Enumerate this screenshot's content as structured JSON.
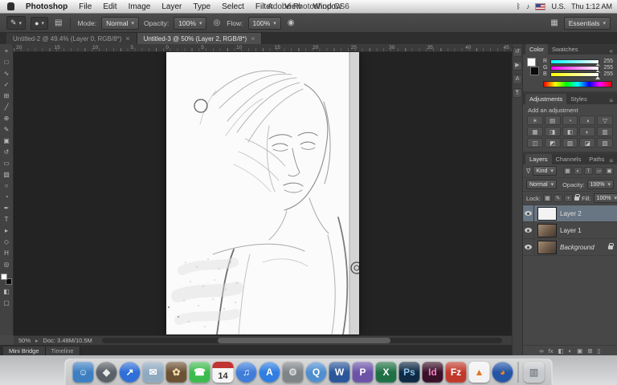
{
  "menubar": {
    "menus": [
      "Photoshop",
      "File",
      "Edit",
      "Image",
      "Layer",
      "Type",
      "Select",
      "Filter",
      "View",
      "Window"
    ],
    "window_title": "Adobe Photoshop CS6",
    "status_icons": [
      {
        "name": "bluetooth-icon",
        "glyph": "ᛒ"
      },
      {
        "name": "volume-icon",
        "glyph": "♪"
      }
    ],
    "input_source": "U.S.",
    "clock": "Thu 1:12 AM"
  },
  "options_bar": {
    "tool_glyph": "✎",
    "brush_preview_glyph": "●",
    "toggle_panel_glyph": "▤",
    "mode_label": "Mode:",
    "mode_value": "Normal",
    "opacity_label": "Opacity:",
    "opacity_value": "100%",
    "pressure_glyph": "◎",
    "flow_label": "Flow:",
    "flow_value": "100%",
    "airbrush_glyph": "◉",
    "workspace_glyph": "▦",
    "workspace_value": "Essentials"
  },
  "document_tabs": [
    {
      "title": "Untitled-2 @ 49.4% (Layer 0, RGB/8*)",
      "close": "×",
      "active": false
    },
    {
      "title": "Untitled-3 @ 50% (Layer 2, RGB/8*)",
      "close": "×",
      "active": true
    }
  ],
  "ruler": {
    "labels": [
      "20",
      "15",
      "10",
      "5",
      "0",
      "5",
      "10",
      "15",
      "20",
      "25",
      "30",
      "35",
      "40",
      "45"
    ]
  },
  "toolbar": {
    "tools": [
      {
        "name": "move-tool",
        "glyph": "+"
      },
      {
        "name": "marquee-tool",
        "glyph": "□"
      },
      {
        "name": "lasso-tool",
        "glyph": "∿"
      },
      {
        "name": "quick-selection-tool",
        "glyph": "✓"
      },
      {
        "name": "crop-tool",
        "glyph": "⊞"
      },
      {
        "name": "eyedropper-tool",
        "glyph": "╱"
      },
      {
        "name": "healing-brush-tool",
        "glyph": "⊕"
      },
      {
        "name": "brush-tool",
        "glyph": "✎"
      },
      {
        "name": "clone-stamp-tool",
        "glyph": "▣"
      },
      {
        "name": "history-brush-tool",
        "glyph": "↺"
      },
      {
        "name": "eraser-tool",
        "glyph": "▭"
      },
      {
        "name": "gradient-tool",
        "glyph": "▨"
      },
      {
        "name": "blur-tool",
        "glyph": "○"
      },
      {
        "name": "dodge-tool",
        "glyph": "◔"
      },
      {
        "name": "pen-tool",
        "glyph": "✒"
      },
      {
        "name": "type-tool",
        "glyph": "T"
      },
      {
        "name": "path-selection-tool",
        "glyph": "▸"
      },
      {
        "name": "shape-tool",
        "glyph": "◇"
      },
      {
        "name": "hand-tool",
        "glyph": "H"
      },
      {
        "name": "zoom-tool",
        "glyph": "◎"
      }
    ],
    "quick_mask_glyph": "◧",
    "screen-mode_glyph": "▢"
  },
  "panel_dock_icons": [
    {
      "name": "history-panel-icon",
      "glyph": "↺"
    },
    {
      "name": "actions-panel-icon",
      "glyph": "▶"
    },
    {
      "name": "character-panel-icon",
      "glyph": "A"
    },
    {
      "name": "paragraph-panel-icon",
      "glyph": "¶"
    }
  ],
  "panels": {
    "color": {
      "tabs": [
        "Color",
        "Swatches"
      ],
      "collapse_glyph": "«",
      "sliders": [
        {
          "channel": "R",
          "value": "255"
        },
        {
          "channel": "G",
          "value": "255"
        },
        {
          "channel": "B",
          "value": "255"
        }
      ]
    },
    "adjustments": {
      "tabs": [
        "Adjustments",
        "Styles"
      ],
      "hint": "Add an adjustment",
      "menu_glyph": "≡",
      "icons": [
        {
          "name": "brightness-contrast-icon",
          "glyph": "☀"
        },
        {
          "name": "levels-icon",
          "glyph": "▤"
        },
        {
          "name": "curves-icon",
          "glyph": "◔"
        },
        {
          "name": "exposure-icon",
          "glyph": "◑"
        },
        {
          "name": "vibrance-icon",
          "glyph": "▽"
        },
        {
          "name": "hue-saturation-icon",
          "glyph": "▦"
        },
        {
          "name": "color-balance-icon",
          "glyph": "◨"
        },
        {
          "name": "black-white-icon",
          "glyph": "◧"
        },
        {
          "name": "photo-filter-icon",
          "glyph": "◐"
        },
        {
          "name": "channel-mixer-icon",
          "glyph": "▥"
        },
        {
          "name": "color-lookup-icon",
          "glyph": "◫"
        },
        {
          "name": "invert-icon",
          "glyph": "◩"
        },
        {
          "name": "posterize-icon",
          "glyph": "▨"
        },
        {
          "name": "threshold-icon",
          "glyph": "◪"
        },
        {
          "name": "selective-color-icon",
          "glyph": "▧"
        }
      ]
    },
    "layers": {
      "tabs": [
        "Layers",
        "Channels",
        "Paths"
      ],
      "menu_glyph": "≡",
      "filter_funnel_glyph": "∇",
      "filter_label": "Kind",
      "filter_icons": [
        {
          "name": "filter-pixel-layers-icon",
          "glyph": "▦"
        },
        {
          "name": "filter-adjustment-layers-icon",
          "glyph": "◐"
        },
        {
          "name": "filter-type-layers-icon",
          "glyph": "T"
        },
        {
          "name": "filter-shape-layers-icon",
          "glyph": "▱"
        },
        {
          "name": "filter-smart-objects-icon",
          "glyph": "▣"
        }
      ],
      "blend_mode": "Normal",
      "opacity_label": "Opacity:",
      "opacity_value": "100%",
      "lock_label": "Lock:",
      "lock_icons": [
        {
          "name": "lock-transparency-icon",
          "glyph": "▦"
        },
        {
          "name": "lock-paint-icon",
          "glyph": "✎"
        },
        {
          "name": "lock-move-icon",
          "glyph": "+"
        },
        {
          "name": "lock-all-icon",
          "glyph": ""
        }
      ],
      "fill_label": "Fill:",
      "fill_value": "100%",
      "rows": [
        {
          "name": "Layer 2",
          "selected": true,
          "thumb": "sketch",
          "locked": false,
          "italic": false
        },
        {
          "name": "Layer 1",
          "selected": false,
          "thumb": "photo",
          "locked": false,
          "italic": false
        },
        {
          "name": "Background",
          "selected": false,
          "thumb": "photo",
          "locked": true,
          "italic": true
        }
      ],
      "footer_icons": [
        {
          "name": "link-layers-icon",
          "glyph": "∞"
        },
        {
          "name": "layer-effects-icon",
          "glyph": "fx"
        },
        {
          "name": "layer-mask-icon",
          "glyph": "◧"
        },
        {
          "name": "adjustment-layer-icon",
          "glyph": "◐"
        },
        {
          "name": "layer-group-icon",
          "glyph": "▣"
        },
        {
          "name": "new-layer-icon",
          "glyph": "⊞"
        },
        {
          "name": "delete-layer-icon",
          "glyph": "▯"
        }
      ]
    }
  },
  "statusbar": {
    "zoom": "50%",
    "arrow_glyph": "▸",
    "doc_info": "Doc: 3.48M/10.5M"
  },
  "bottom_tabs": [
    "Mini Bridge",
    "Timeline"
  ],
  "dock": {
    "items": [
      {
        "name": "finder-icon",
        "color": "#3e7fc1",
        "shape": "square",
        "glyph": "☺",
        "glyph_color": "#eaf4fd"
      },
      {
        "name": "launchpad-icon",
        "color": "#5a6067",
        "shape": "circle",
        "glyph": "◆",
        "glyph_color": "#e8e8e8"
      },
      {
        "name": "safari-icon",
        "color": "#2f6fd6",
        "shape": "circle",
        "glyph": "↗",
        "glyph_color": "#ffffff"
      },
      {
        "name": "mail-icon",
        "color": "#8fa9c0",
        "shape": "square",
        "glyph": "✉",
        "glyph_color": "#ffffff"
      },
      {
        "name": "iphoto-icon",
        "color": "#6b5234",
        "shape": "square",
        "glyph": "✿",
        "glyph_color": "#f0d9a8"
      },
      {
        "name": "facetime-icon",
        "color": "#3dbb4e",
        "shape": "square",
        "glyph": "☎",
        "glyph_color": "#ffffff"
      },
      {
        "name": "calendar-icon",
        "color": "#f6f6f6",
        "shape": "square",
        "glyph": "14",
        "glyph_color": "#333333"
      },
      {
        "name": "itunes-icon",
        "color": "#3f7dd9",
        "shape": "circle",
        "glyph": "♫",
        "glyph_color": "#ffffff"
      },
      {
        "name": "appstore-icon",
        "color": "#2f7de0",
        "shape": "circle",
        "glyph": "A",
        "glyph_color": "#ffffff"
      },
      {
        "name": "system-preferences-icon",
        "color": "#7f8487",
        "shape": "square",
        "glyph": "⚙",
        "glyph_color": "#e0e0e0"
      },
      {
        "name": "quicktime-icon",
        "color": "#4f8fd0",
        "shape": "circle",
        "glyph": "Q",
        "glyph_color": "#ffffff"
      },
      {
        "name": "word-icon",
        "color": "#2b579a",
        "shape": "square",
        "glyph": "W",
        "glyph_color": "#ffffff"
      },
      {
        "name": "powerpoint-icon",
        "color": "#6c53a8",
        "shape": "square",
        "glyph": "P",
        "glyph_color": "#ffffff"
      },
      {
        "name": "excel-icon",
        "color": "#1f7145",
        "shape": "square",
        "glyph": "X",
        "glyph_color": "#ffffff"
      },
      {
        "name": "photoshop-icon",
        "color": "#0f2a44",
        "shape": "square",
        "glyph": "Ps",
        "glyph_color": "#8ec0e8"
      },
      {
        "name": "indesign-icon",
        "color": "#3a1128",
        "shape": "square",
        "glyph": "Id",
        "glyph_color": "#ee84c0"
      },
      {
        "name": "filezilla-icon",
        "color": "#c0392b",
        "shape": "square",
        "glyph": "Fz",
        "glyph_color": "#ffffff"
      },
      {
        "name": "vlc-icon",
        "color": "#f2f2f2",
        "shape": "square",
        "glyph": "▲",
        "glyph_color": "#e8731a"
      },
      {
        "name": "firefox-icon",
        "color": "#2456a8",
        "shape": "circle",
        "glyph": "◕",
        "glyph_color": "#f5831f"
      },
      {
        "separator": true
      },
      {
        "name": "trash-icon",
        "color": "#c7cacd",
        "shape": "square",
        "glyph": "▥",
        "glyph_color": "#84898e"
      }
    ]
  }
}
